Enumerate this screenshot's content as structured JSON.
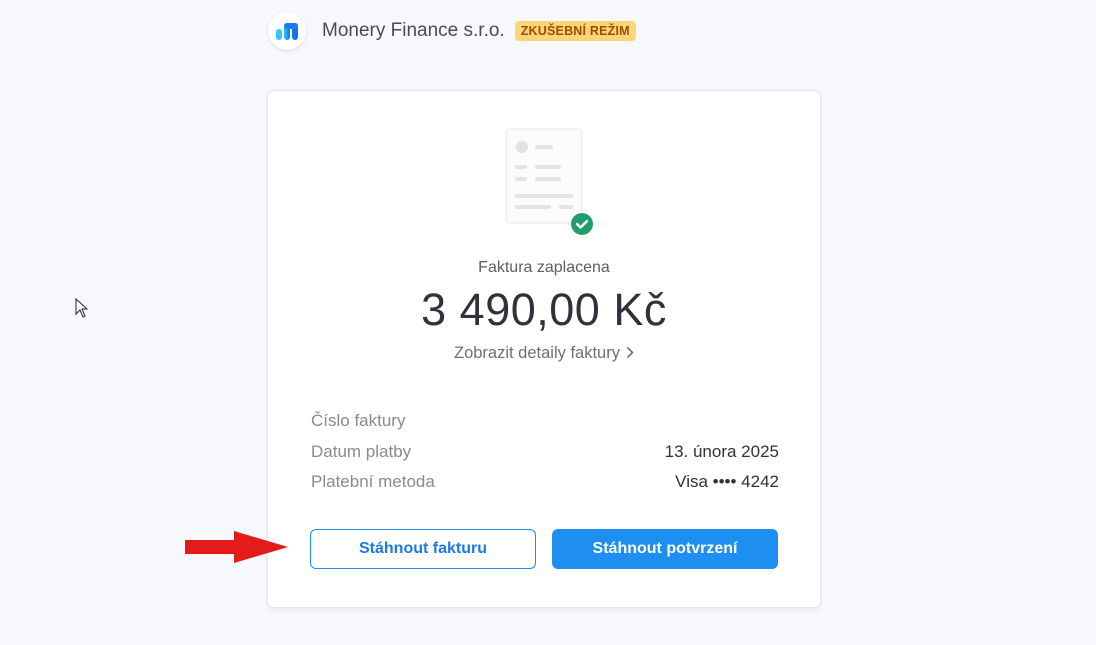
{
  "header": {
    "company_name": "Monery Finance s.r.o.",
    "mode_badge": "ZKUŠEBNÍ REŽIM",
    "logo_icon": "monery-logo"
  },
  "invoice": {
    "status": "Faktura zaplacena",
    "amount": "3 490,00 Kč",
    "details_link": "Zobrazit detaily faktury",
    "rows": [
      {
        "label": "Číslo faktury",
        "value": ""
      },
      {
        "label": "Datum platby",
        "value": "13. února 2025"
      },
      {
        "label": "Platební metoda",
        "value": "Visa •••• 4242"
      }
    ]
  },
  "actions": {
    "download_invoice": "Stáhnout fakturu",
    "download_receipt": "Stáhnout potvrzení"
  },
  "colors": {
    "accent": "#1f8ef1",
    "badge_bg": "#fcd576",
    "badge_text": "#a14b05",
    "success": "#1e9e6b",
    "annotation_arrow": "#e31b1b"
  }
}
